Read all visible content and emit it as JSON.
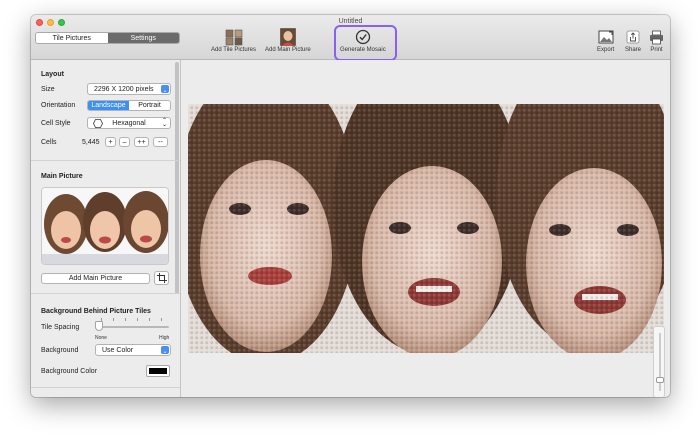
{
  "window": {
    "title": "Untitled"
  },
  "sidebar_tabs": [
    {
      "label": "Tile Pictures"
    },
    {
      "label": "Settings"
    }
  ],
  "toolbar": {
    "add_tiles": "Add Tile Pictures",
    "add_main": "Add Main Picture",
    "generate": "Generate Mosaic",
    "export": "Export",
    "share": "Share",
    "print": "Print"
  },
  "layout": {
    "heading": "Layout",
    "size_label": "Size",
    "size_value": "2296 X 1200 pixels",
    "orientation_label": "Orientation",
    "orientation_options": [
      "Landscape",
      "Portrait"
    ],
    "cell_style_label": "Cell Style",
    "cell_style_value": "Hexagonal",
    "cells_label": "Cells",
    "cells_value": "5,445",
    "cells_buttons": [
      "+",
      "–",
      "++",
      "--"
    ]
  },
  "main_picture": {
    "heading": "Main Picture",
    "add_button": "Add Main Picture"
  },
  "background": {
    "heading": "Background Behind Picture Tiles",
    "tile_spacing_label": "Tile Spacing",
    "slider_min": "None",
    "slider_max": "High",
    "tile_spacing_level": 0.0,
    "background_label": "Background",
    "background_value": "Use Color",
    "background_color_label": "Background Color",
    "background_color": "#000000"
  },
  "zoom": {
    "level": 0.15
  },
  "colors": {
    "accent": "#3d8ef5",
    "highlight_ring": "#8a60f0"
  },
  "icons": [
    "tile-pictures-icon",
    "main-picture-icon",
    "generate-mosaic-icon",
    "export-icon",
    "share-icon",
    "print-icon",
    "hexagon-icon",
    "crop-icon"
  ]
}
